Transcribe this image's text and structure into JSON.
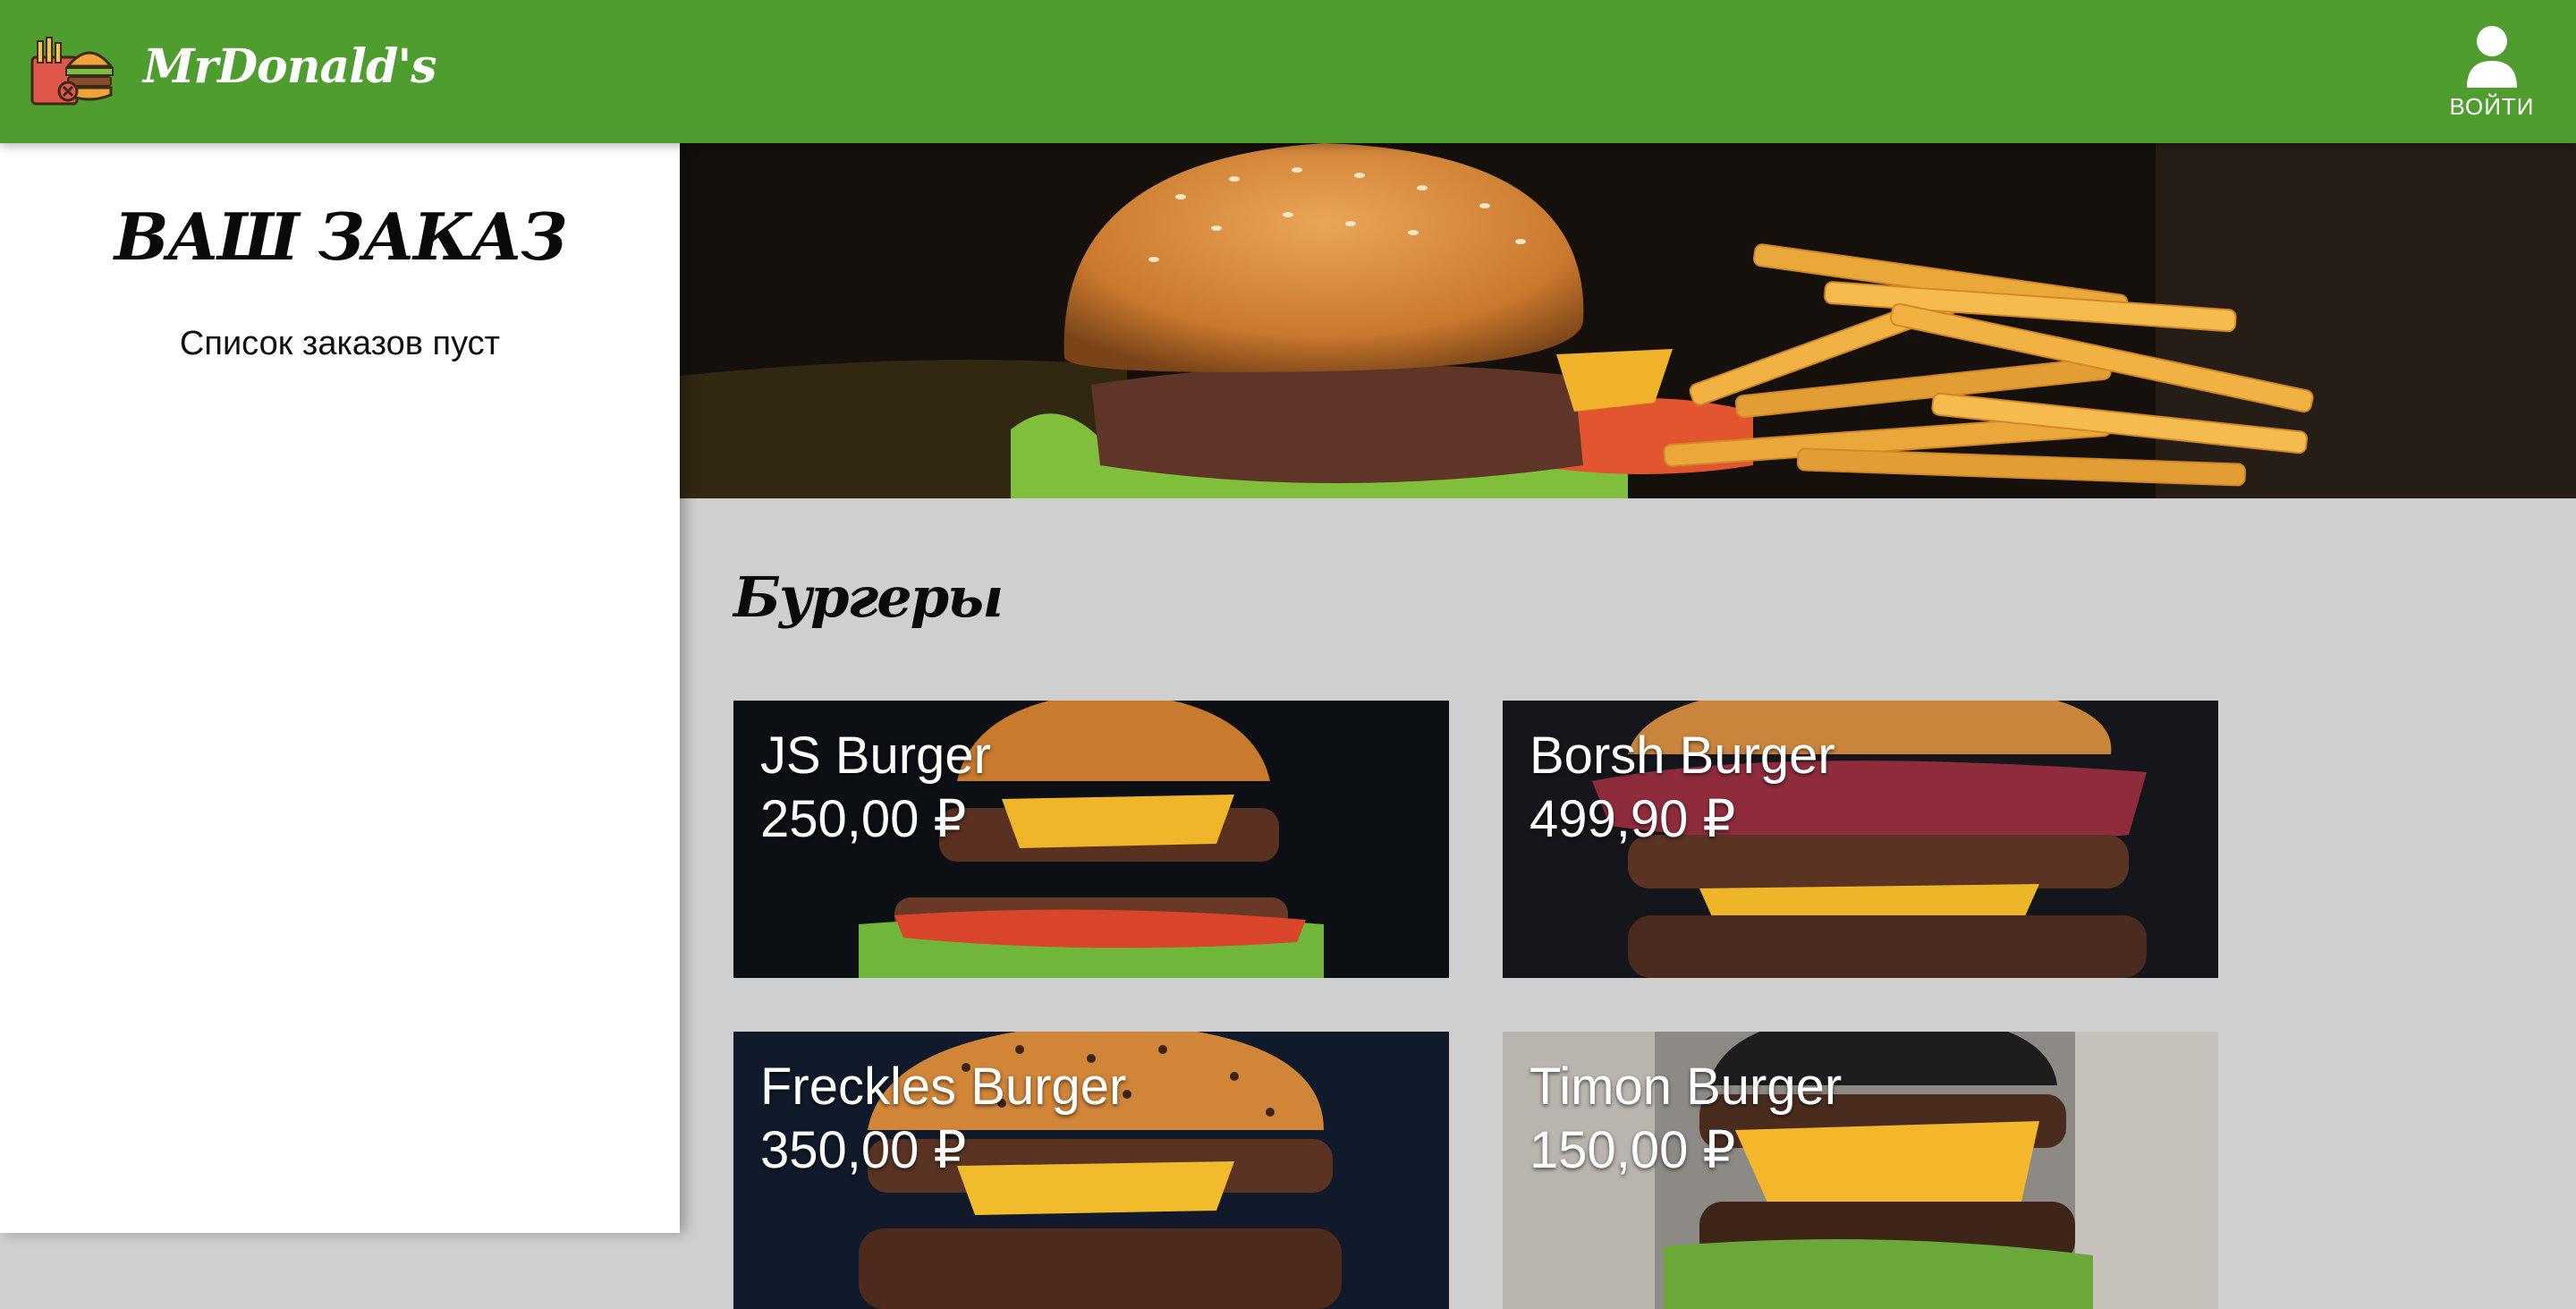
{
  "header": {
    "brand": "MrDonald's",
    "logo_icon": "burger-fries-logo-icon",
    "login_label": "ВОЙТИ",
    "login_icon": "user-icon",
    "color": "#4f9d2f"
  },
  "sidebar": {
    "title": "ВАШ ЗАКАЗ",
    "empty_text": "Список заказов пуст"
  },
  "hero": {
    "image": "burger-and-fries-banner"
  },
  "menu": {
    "section_title": "Бургеры",
    "items": [
      {
        "name": "JS Burger",
        "price": "250,00 ₽"
      },
      {
        "name": "Borsh Burger",
        "price": "499,90 ₽"
      },
      {
        "name": "Freckles Burger",
        "price": "350,00 ₽"
      },
      {
        "name": "Timon Burger",
        "price": "150,00 ₽"
      }
    ]
  }
}
